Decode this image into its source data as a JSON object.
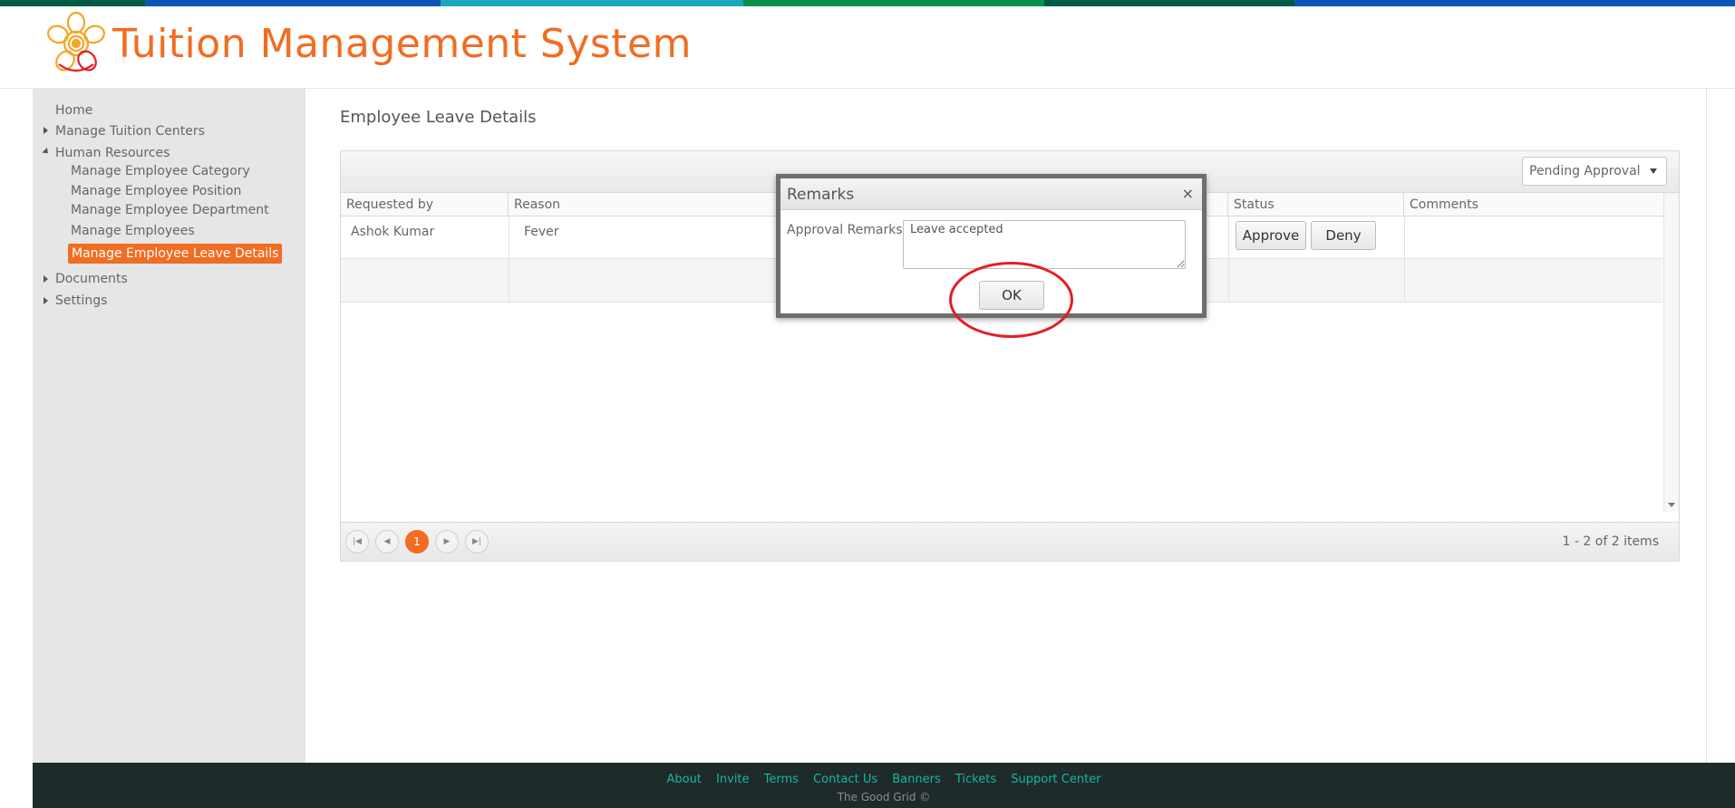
{
  "header": {
    "app_title": "Tuition Management System"
  },
  "colors": {
    "accent": "#f26c22",
    "footer_bg": "#1f2a2a",
    "footer_link": "#15b7a3",
    "top_bar": [
      "#005b45",
      "#0b57b5",
      "#1aa7b9",
      "#05914a",
      "#0b57b5"
    ]
  },
  "sidebar": {
    "items": [
      {
        "label": "Home"
      },
      {
        "label": "Manage Tuition Centers"
      },
      {
        "label": "Human Resources"
      },
      {
        "label": "Manage Employee Category"
      },
      {
        "label": "Manage Employee Position"
      },
      {
        "label": "Manage Employee Department"
      },
      {
        "label": "Manage Employees"
      },
      {
        "label": "Manage Employee Leave Details"
      },
      {
        "label": "Documents"
      },
      {
        "label": "Settings"
      }
    ]
  },
  "main": {
    "page_title": "Employee Leave Details",
    "filter": {
      "selected": "Pending Approval"
    },
    "columns": [
      "Requested by",
      "Reason",
      "Status",
      "Comments"
    ],
    "rows": [
      {
        "requested_by": "Ashok Kumar",
        "reason": "Fever",
        "approve_label": "Approve",
        "deny_label": "Deny"
      }
    ],
    "pager": {
      "first_icon": "first-page-icon",
      "prev_icon": "prev-page-icon",
      "current_page": "1",
      "next_icon": "next-page-icon",
      "last_icon": "last-page-icon",
      "info": "1 - 2 of 2 items"
    }
  },
  "modal": {
    "title": "Remarks",
    "close": "×",
    "label": "Approval Remarks",
    "value": "Leave accepted",
    "ok_label": "OK"
  },
  "footer": {
    "links": [
      "About",
      "Invite",
      "Terms",
      "Contact Us",
      "Banners",
      "Tickets",
      "Support Center"
    ],
    "copyright": "The Good Grid ©"
  }
}
